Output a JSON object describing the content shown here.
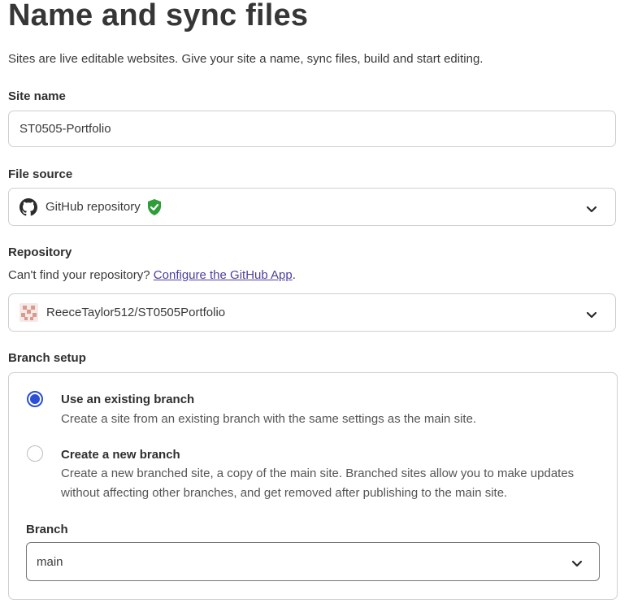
{
  "header": {
    "title": "Name and sync files",
    "subtitle": "Sites are live editable websites. Give your site a name, sync files, build and start editing."
  },
  "site_name": {
    "label": "Site name",
    "value": "ST0505-Portfolio"
  },
  "file_source": {
    "label": "File source",
    "value": "GitHub repository",
    "icon": "github-icon",
    "verified_icon": "verified-shield-icon",
    "verified_color": "#2f9e3a"
  },
  "repository": {
    "label": "Repository",
    "helper_text": "Can't find your repository?",
    "helper_link": "Configure the GitHub App",
    "helper_suffix": ".",
    "value": "ReeceTaylor512/ST0505Portfolio",
    "avatar_icon": "repo-avatar-icon"
  },
  "branch_setup": {
    "label": "Branch setup",
    "accent_color": "#2b4fd6",
    "options": [
      {
        "title": "Use an existing branch",
        "description": "Create a site from an existing branch with the same settings as the main site.",
        "selected": true
      },
      {
        "title": "Create a new branch",
        "description": "Create a new branched site, a copy of the main site. Branched sites allow you to make updates without affecting other branches, and get removed after publishing to the main site.",
        "selected": false
      }
    ],
    "branch": {
      "label": "Branch",
      "value": "main"
    }
  }
}
